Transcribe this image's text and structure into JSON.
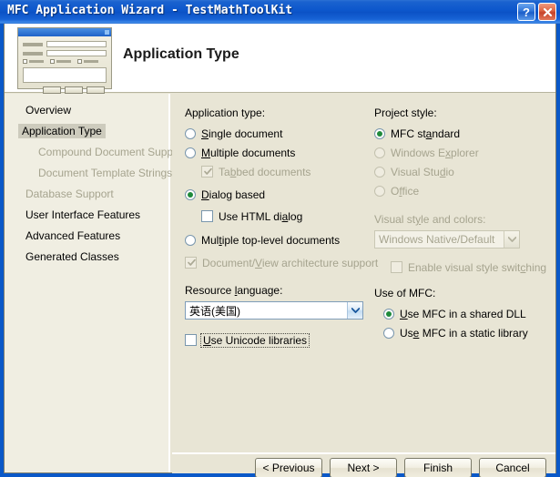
{
  "window": {
    "title": "MFC Application Wizard - TestMathToolKit",
    "help_button": "?",
    "close_button": "✕"
  },
  "header": {
    "title": "Application Type",
    "preview_icon": "dialog-preview-thumbnail"
  },
  "sidebar": {
    "items": [
      {
        "label": "Overview",
        "state": "enabled"
      },
      {
        "label": "Application Type",
        "state": "selected"
      },
      {
        "label": "Compound Document Support",
        "state": "disabled"
      },
      {
        "label": "Document Template Strings",
        "state": "disabled"
      },
      {
        "label": "Database Support",
        "state": "disabled"
      },
      {
        "label": "User Interface Features",
        "state": "enabled"
      },
      {
        "label": "Advanced Features",
        "state": "enabled"
      },
      {
        "label": "Generated Classes",
        "state": "enabled"
      }
    ]
  },
  "application_type": {
    "group_label": "Application type:",
    "options": [
      {
        "label_pre": "",
        "label_mnemonic": "S",
        "label_post": "ingle document",
        "type": "radio",
        "checked": false,
        "disabled": false
      },
      {
        "label_pre": "",
        "label_mnemonic": "M",
        "label_post": "ultiple documents",
        "type": "radio",
        "checked": false,
        "disabled": false
      },
      {
        "label_pre": "Ta",
        "label_mnemonic": "b",
        "label_post": "bed documents",
        "type": "checkbox",
        "checked": true,
        "disabled": true
      },
      {
        "label_pre": "",
        "label_mnemonic": "D",
        "label_post": "ialog based",
        "type": "radio",
        "checked": true,
        "disabled": false
      },
      {
        "label_pre": "Use HTML di",
        "label_mnemonic": "a",
        "label_post": "log",
        "type": "checkbox",
        "checked": false,
        "disabled": false
      },
      {
        "label_pre": "Mul",
        "label_mnemonic": "t",
        "label_post": "iple top-level documents",
        "type": "radio",
        "checked": false,
        "disabled": false
      },
      {
        "label_pre": "Document/",
        "label_mnemonic": "V",
        "label_post": "iew architecture support",
        "type": "checkbox",
        "checked": true,
        "disabled": true
      }
    ]
  },
  "resource_language": {
    "label_pre": "Resource ",
    "label_mnemonic": "l",
    "label_post": "anguage:",
    "value": "英语(美国)",
    "arrow_icon": "chevron-down-icon"
  },
  "unicode": {
    "label_pre": "",
    "label_mnemonic": "U",
    "label_post": "se Unicode libraries",
    "checked": false,
    "focused": true
  },
  "project_style": {
    "group_label": "Project style:",
    "options": [
      {
        "label_pre": "MFC st",
        "label_mnemonic": "a",
        "label_post": "ndard",
        "checked": true,
        "disabled": false
      },
      {
        "label_pre": "Windows E",
        "label_mnemonic": "x",
        "label_post": "plorer",
        "checked": false,
        "disabled": true
      },
      {
        "label_pre": "Visual Stu",
        "label_mnemonic": "d",
        "label_post": "io",
        "checked": false,
        "disabled": true
      },
      {
        "label_pre": "O",
        "label_mnemonic": "f",
        "label_post": "fice",
        "checked": false,
        "disabled": true
      }
    ]
  },
  "visual_style": {
    "label_pre": "Visual st",
    "label_mnemonic": "y",
    "label_post": "le and colors:",
    "value": "Windows Native/Default",
    "disabled": true,
    "arrow_icon": "chevron-down-icon"
  },
  "visual_switching": {
    "label_pre": "Enable visual style swit",
    "label_mnemonic": "c",
    "label_post": "hing",
    "checked": false,
    "disabled": true
  },
  "use_of_mfc": {
    "group_label": "Use of MFC:",
    "options": [
      {
        "label_pre": "",
        "label_mnemonic": "U",
        "label_post": "se MFC in a shared DLL",
        "checked": true,
        "disabled": false
      },
      {
        "label_pre": "Us",
        "label_mnemonic": "e",
        "label_post": " MFC in a static library",
        "checked": false,
        "disabled": false
      }
    ]
  },
  "footer": {
    "buttons": [
      {
        "label": "< Previous"
      },
      {
        "label": "Next >"
      },
      {
        "label": "Finish"
      },
      {
        "label": "Cancel"
      }
    ]
  },
  "colors": {
    "titlebar_blue": "#0D57CC",
    "sidebar_bg": "#F0EEE2",
    "content_bg": "#E8E5D5",
    "selected_nav_bg": "#CDCBBD",
    "radio_dot_green": "#1F8A3C",
    "disabled_text": "#A6A48F"
  }
}
